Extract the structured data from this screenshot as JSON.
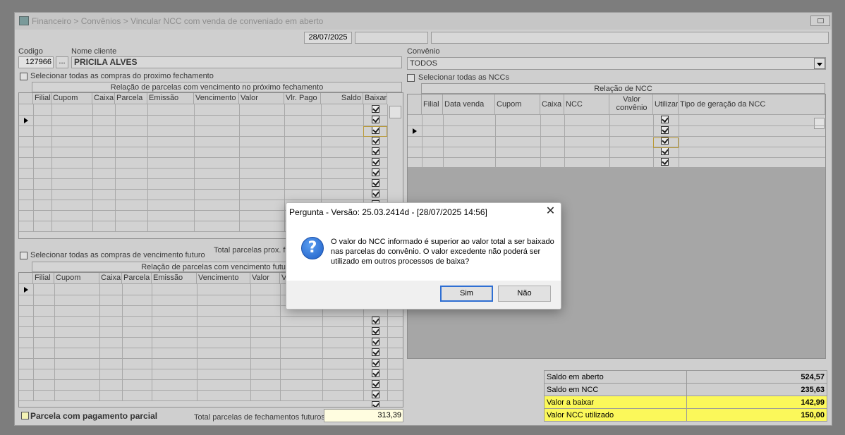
{
  "window": {
    "title": "Financeiro > Convênios > Vincular NCC com venda de conveniado em aberto",
    "date": "28/07/2025"
  },
  "left": {
    "codigo_label": "Codigo",
    "codigo_value": "127966",
    "lookup_button": "...",
    "nome_label": "Nome cliente",
    "nome_value": "PRICILA ALVES",
    "select_next_label": "Selecionar todas as compras do proximo fechamento",
    "grid1_caption": "Relação de parcelas com vencimento no próximo fechamento",
    "grid1_columns": [
      "Filial",
      "Cupom",
      "Caixa",
      "Parcela",
      "Emissão",
      "Vencimento",
      "Valor",
      "Vlr. Pago",
      "Saldo",
      "Baixar"
    ],
    "select_future_label": "Selecionar todas as compras de vencimento futuro",
    "total_next_label": "Total parcelas prox. fe",
    "grid2_caption": "Relação de parcelas com vencimento futuro",
    "grid2_columns": [
      "Filial",
      "Cupom",
      "Caixa",
      "Parcela",
      "Emissão",
      "Vencimento",
      "Valor",
      "V"
    ],
    "partial_label": "Parcela com pagamento parcial",
    "total_future_label": "Total parcelas de fechamentos futuros",
    "total_future_value": "313,39"
  },
  "right": {
    "convenio_label": "Convênio",
    "convenio_value": "TODOS",
    "select_ncc_label": "Selecionar todas as NCCs",
    "grid_caption": "Relação de NCC",
    "grid_columns": [
      "Filial",
      "Data venda",
      "Cupom",
      "Caixa",
      "NCC",
      "Valor convênio",
      "Utilizar",
      "Tipo de geração da NCC"
    ]
  },
  "summary": [
    {
      "label": "Saldo em aberto",
      "value": "524,57",
      "highlight": false
    },
    {
      "label": "Saldo em NCC",
      "value": "235,63",
      "highlight": false
    },
    {
      "label": "Valor a baixar",
      "value": "142,99",
      "highlight": true
    },
    {
      "label": "Valor NCC utilizado",
      "value": "150,00",
      "highlight": true
    }
  ],
  "dialog": {
    "title": "Pergunta - Versão: 25.03.2414d - [28/07/2025 14:56]",
    "message": "O valor do NCC informado é superior ao valor total a ser baixado nas parcelas do convênio. O valor excedente não poderá ser utilizado em outros processos de baixa?",
    "icon": "?",
    "close": "✕",
    "yes": "Sim",
    "no": "Não"
  },
  "colors": {
    "highlight": "#fbf85a",
    "dialog_accent": "#2f6fd3"
  }
}
